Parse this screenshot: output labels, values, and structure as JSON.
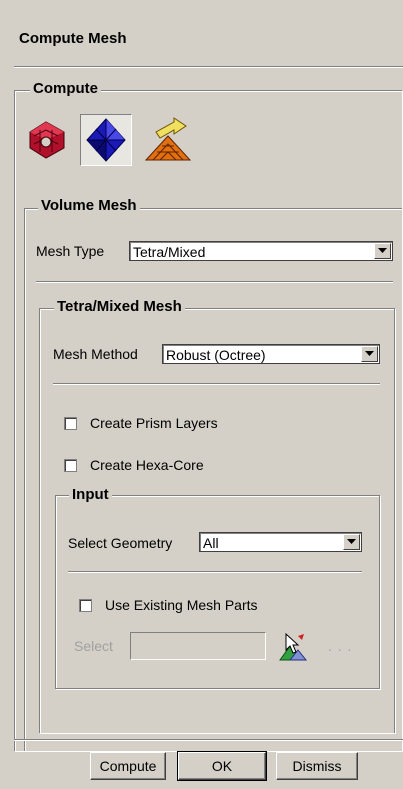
{
  "panel": {
    "title": "Compute Mesh"
  },
  "compute": {
    "legend": "Compute",
    "icons": [
      "volume-mesh-icon",
      "tetra-mesh-icon",
      "prism-mesh-icon"
    ]
  },
  "volume_mesh": {
    "legend": "Volume Mesh",
    "mesh_type_label": "Mesh Type",
    "mesh_type_value": "Tetra/Mixed"
  },
  "tetra_mixed": {
    "legend": "Tetra/Mixed Mesh",
    "mesh_method_label": "Mesh Method",
    "mesh_method_value": "Robust (Octree)",
    "create_prism_layers": "Create Prism Layers",
    "create_hexa_core": "Create Hexa-Core"
  },
  "input": {
    "legend": "Input",
    "select_geometry_label": "Select Geometry",
    "select_geometry_value": "All",
    "use_existing_mesh_parts": "Use Existing Mesh Parts",
    "select_label": "Select",
    "select_value": "",
    "ellipsis": ". . ."
  },
  "buttons": {
    "compute": "Compute",
    "ok": "OK",
    "dismiss": "Dismiss"
  }
}
